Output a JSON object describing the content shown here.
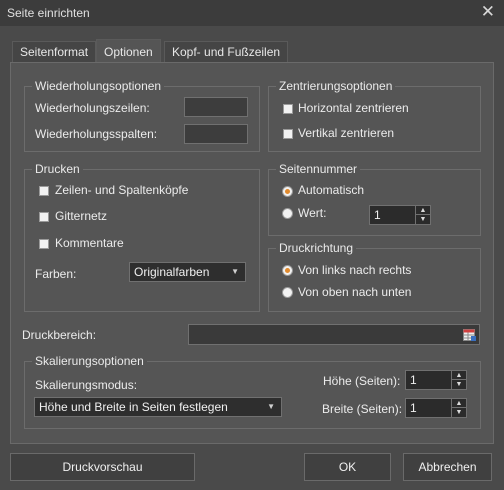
{
  "window": {
    "title": "Seite einrichten",
    "close_symbol": "✕"
  },
  "tabs": [
    {
      "label": "Seitenformat"
    },
    {
      "label": "Optionen",
      "active": true
    },
    {
      "label": "Kopf- und Fußzeilen"
    }
  ],
  "repeat": {
    "legend": "Wiederholungsoptionen",
    "rows_label": "Wiederholungszeilen:",
    "cols_label": "Wiederholungsspalten:",
    "rows_value": "",
    "cols_value": ""
  },
  "centering": {
    "legend": "Zentrierungsoptionen",
    "horizontal": "Horizontal zentrieren",
    "vertical": "Vertikal zentrieren"
  },
  "print": {
    "legend": "Drucken",
    "headers": "Zeilen- und Spaltenköpfe",
    "gridlines": "Gitternetz",
    "comments": "Kommentare",
    "colors_label": "Farben:",
    "colors_value": "Originalfarben"
  },
  "page_number": {
    "legend": "Seitennummer",
    "auto": "Automatisch",
    "value_label": "Wert:",
    "value": "1"
  },
  "direction": {
    "legend": "Druckrichtung",
    "lr": "Von links nach rechts",
    "tb": "Von oben nach unten"
  },
  "print_area": {
    "label": "Druckbereich:",
    "value": ""
  },
  "scaling": {
    "legend": "Skalierungsoptionen",
    "mode_label": "Skalierungsmodus:",
    "mode_value": "Höhe und Breite in Seiten festlegen",
    "height_label": "Höhe (Seiten):",
    "height_value": "1",
    "width_label": "Breite (Seiten):",
    "width_value": "1"
  },
  "buttons": {
    "preview": "Druckvorschau",
    "ok": "OK",
    "cancel": "Abbrechen"
  }
}
